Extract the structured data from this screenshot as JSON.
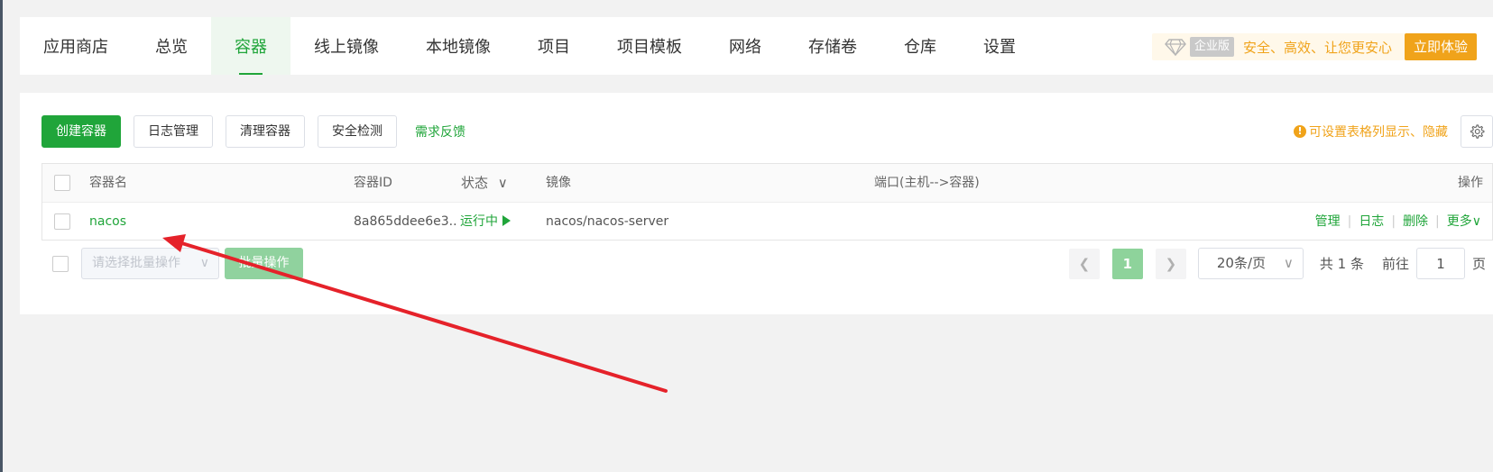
{
  "nav": {
    "tabs": [
      "应用商店",
      "总览",
      "容器",
      "线上镜像",
      "本地镜像",
      "项目",
      "项目模板",
      "网络",
      "存储卷",
      "仓库",
      "设置"
    ],
    "active_tab": "容器"
  },
  "promo": {
    "edition": "企业版",
    "slogan": "安全、高效、让您更安心",
    "button": "立即体验"
  },
  "toolbar": {
    "create": "创建容器",
    "logs": "日志管理",
    "clean": "清理容器",
    "security": "安全检测",
    "feedback": "需求反馈",
    "tip": "可设置表格列显示、隐藏"
  },
  "table": {
    "headers": {
      "name": "容器名",
      "id": "容器ID",
      "status": "状态",
      "image": "镜像",
      "ports": "端口(主机-->容器)",
      "ops": "操作"
    },
    "rows": [
      {
        "name": "nacos",
        "id": "8a865ddee6e3..",
        "status": "运行中",
        "image": "nacos/nacos-server",
        "ports": "",
        "ops": {
          "manage": "管理",
          "log": "日志",
          "delete": "删除",
          "more": "更多"
        }
      }
    ]
  },
  "batch": {
    "placeholder": "请选择批量操作",
    "button": "批量操作"
  },
  "pagination": {
    "current_page": "1",
    "page_size": "20条/页",
    "total": "共 1 条",
    "goto_prefix": "前往",
    "goto_value": "1",
    "goto_suffix": "页"
  },
  "colors": {
    "accent": "#20a53a",
    "warning": "#f0a31a",
    "annotation_arrow": "#e5222a"
  }
}
